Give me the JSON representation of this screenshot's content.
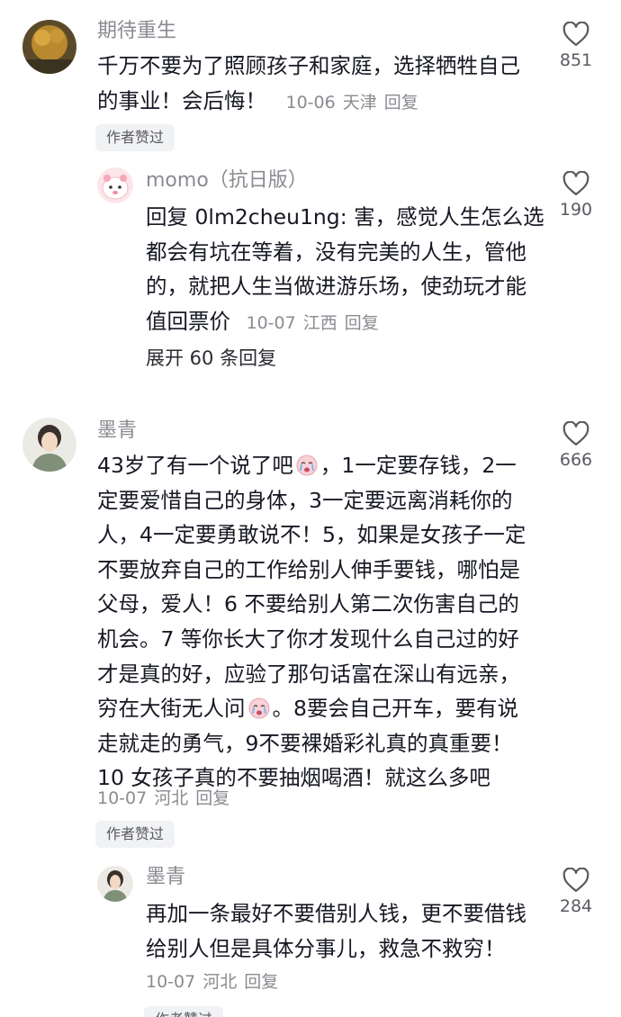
{
  "comments": [
    {
      "author": "期待重生",
      "lines": [
        "千万不要为了照顾孩子和家庭，选择牺牲自己",
        "的事业！会后悔！"
      ],
      "date": "10-06",
      "location": "天津",
      "reply_label": "回复",
      "likes": "851",
      "author_tag": "作者赞过",
      "replies": [
        {
          "author": "momo（抗日版）",
          "lines": [
            "回复 0lm2cheu1ng: 害，感觉人生怎么选",
            "都会有坑在等着，没有完美的人生，管他",
            "的，就把人生当做进游乐场，使劲玩才能",
            "值回票价"
          ],
          "date": "10-07",
          "location": "江西",
          "reply_label": "回复",
          "likes": "190"
        }
      ],
      "expand_label": "展开 60 条回复"
    },
    {
      "author": "墨青",
      "lines": [
        [
          "43岁了有一个说了吧",
          "",
          "，1一定要存钱，2一"
        ],
        "定要爱惜自己的身体，3一定要远离消耗你的",
        "人，4一定要勇敢说不！5，如果是女孩子一定",
        "不要放弃自己的工作给别人伸手要钱，哪怕是",
        "父母，爱人！6 不要给别人第二次伤害自己的",
        "机会。7 等你长大了你才发现什么自己过的好",
        "才是真的好，应验了那句话富在深山有远亲，",
        [
          "穷在大街无人问",
          "",
          "。8要会自己开车，要有说"
        ],
        "走就走的勇气，9不要裸婚彩礼真的真重要！",
        "10 女孩子真的不要抽烟喝酒！就这么多吧"
      ],
      "date": "10-07",
      "location": "河北",
      "reply_label": "回复",
      "likes": "666",
      "author_tag": "作者赞过",
      "replies": [
        {
          "author": "墨青",
          "lines": [
            "再加一条最好不要借别人钱，更不要借钱",
            "给别人但是具体分事儿，救急不救穷！"
          ],
          "date": "10-07",
          "location": "河北",
          "reply_label": "回复",
          "likes": "284",
          "author_tag": "作者赞过"
        }
      ]
    }
  ],
  "icons": {
    "like": "heart-outline-icon",
    "emoji": "crying-face-emoji"
  },
  "colors": {
    "text": "#161823",
    "meta": "#8a8b91",
    "tag_bg": "#f1f2f4"
  }
}
